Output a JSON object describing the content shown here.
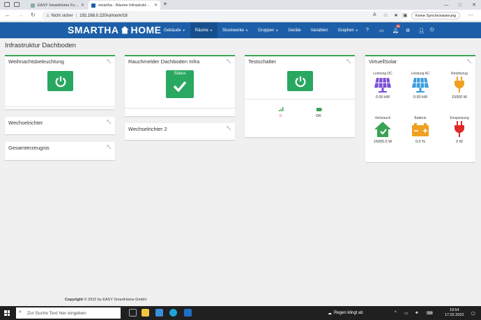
{
  "browser": {
    "tabs": [
      {
        "title": "EASY SmartHome Forum",
        "active": false
      },
      {
        "title": "smartha - Räume Infrastruktur D...",
        "active": true
      }
    ],
    "security_label": "Nicht sicher",
    "url": "192.168.0.220/ui/room/18",
    "sync_label": "Keine Synchronisierung"
  },
  "app": {
    "brand_left": "SMARTHA",
    "brand_right": "HOME",
    "menu": [
      {
        "label": "Gebäude",
        "dropdown": true
      },
      {
        "label": "Räume",
        "dropdown": true
      },
      {
        "label": "Stockwerke",
        "dropdown": true
      },
      {
        "label": "Gruppen",
        "dropdown": true
      },
      {
        "label": "Geräte",
        "dropdown": false
      },
      {
        "label": "Variablen",
        "dropdown": false
      },
      {
        "label": "Graphen",
        "dropdown": true
      }
    ],
    "notification_count": "46"
  },
  "page": {
    "title": "Infrastruktur Dachboden",
    "cards": {
      "weihnacht": {
        "title": "Weihnachtsbeleuchtung"
      },
      "wechselrichter": {
        "title": "Wechselrichter"
      },
      "gesamt": {
        "title": "Gesamterzeugnis"
      },
      "rauchmelder": {
        "title": "Rauchmelder Dachboden Infra",
        "status_label": "Status"
      },
      "wechselrichter2": {
        "title": "Wechselrichter 2"
      },
      "testschalter": {
        "title": "Testschalter",
        "signal_value": "0",
        "battery_value": "OK"
      },
      "virtuellsolar": {
        "title": "VirtuellSolar",
        "metrics": [
          {
            "label": "Leistung DC",
            "value": "0.00 kW",
            "icon": "solar-panel-icon",
            "color": "#7b4fd6"
          },
          {
            "label": "Leistung AC",
            "value": "0.00 kW",
            "icon": "solar-panel-icon",
            "color": "#3a9de0"
          },
          {
            "label": "Netzbezug",
            "value": "15000 W",
            "icon": "plug-icon",
            "color": "#f0a020"
          },
          {
            "label": "Verbrauch",
            "value": "15005.0 W",
            "icon": "house-icon",
            "color": "#3aa356"
          },
          {
            "label": "Batterie",
            "value": "0.0 %",
            "icon": "battery-icon",
            "color": "#f0a020"
          },
          {
            "label": "Einspeisung",
            "value": "0 W",
            "icon": "plug-icon",
            "color": "#e02828"
          }
        ]
      }
    }
  },
  "footer": {
    "copyright_bold": "Copyright",
    "copyright_text": "© 2022 by EASY SmartHome GmbH"
  },
  "taskbar": {
    "search_placeholder": "Zur Suche Text hier eingeben",
    "weather": "Regen klingt ab",
    "time": "19:54",
    "date": "17.02.2022"
  },
  "colors": {
    "brand": "#1c5fa8",
    "accent": "#28a860"
  }
}
